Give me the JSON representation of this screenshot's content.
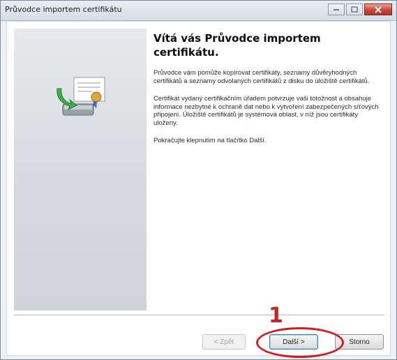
{
  "window": {
    "title": "Průvodce importem certifikátu"
  },
  "content": {
    "heading": "Vítá vás Průvodce importem certifikátu.",
    "paragraphs": [
      "Průvodce vám pomůže kopírovat certifikáty, seznamy důvěryhodných certifikátů a seznamy odvolaných certifikátů z disku do úložiště certifikátů.",
      "Certifikát vydaný certifikačním úřadem potvrzuje vaši totožnost a obsahuje informace nezbytné k ochraně dat nebo k vytvoření zabezpečených síťových připojení. Úložiště certifikátů je systémová oblast, v níž jsou certifikáty uloženy.",
      "Pokračujte klepnutím na tlačítko Další."
    ]
  },
  "buttons": {
    "back": "< Zpět",
    "next": "Další >",
    "cancel": "Storno"
  },
  "annotation": {
    "number": "1"
  },
  "colors": {
    "annotation": "#d21e1e",
    "close_button": "#c8473a"
  },
  "icons": {
    "wizard_graphic": "certificate-import-icon",
    "minimize": "minimize-icon",
    "maximize": "maximize-icon",
    "close": "close-icon"
  }
}
